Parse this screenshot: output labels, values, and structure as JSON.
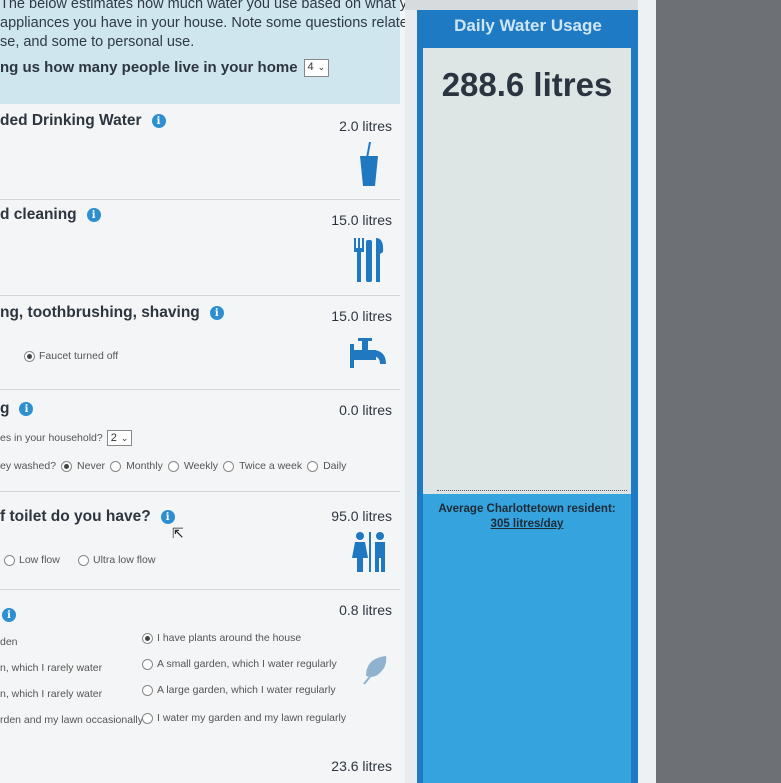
{
  "intro": {
    "line1": "The below estimates how much water you use based on what you do, and",
    "line2": "appliances you have in your house. Note some questions relate to",
    "line3": "se, and some to personal use.",
    "people_label": "ng us how many people live in your home",
    "people_value": "4"
  },
  "sections": {
    "drinking": {
      "title": "ded Drinking Water",
      "litres": "2.0 litres"
    },
    "cleaning": {
      "title": "d cleaning",
      "litres": "15.0 litres"
    },
    "brushing": {
      "title": "ng, toothbrushing, shaving",
      "litres": "15.0 litres",
      "option": "Faucet turned off"
    },
    "washing": {
      "title": "g",
      "litres": "0.0 litres",
      "q1": "es in your household?",
      "q1_value": "2",
      "q2": "ey washed?",
      "options": [
        "Never",
        "Monthly",
        "Weekly",
        "Twice a week",
        "Daily"
      ]
    },
    "toilet": {
      "title": "f toilet do you have?",
      "litres": "95.0 litres",
      "options": [
        "Low flow",
        "Ultra low flow"
      ]
    },
    "garden": {
      "litres": "0.8 litres",
      "left_options": [
        "den",
        "n, which I rarely water",
        "n, which I rarely water",
        "rden and my lawn occasionally"
      ],
      "right_options": [
        "I have plants around the house",
        "A small garden, which I water regularly",
        "A large garden, which I water regularly",
        "I water my garden and my lawn regularly"
      ]
    },
    "last": {
      "litres": "23.6 litres"
    }
  },
  "panel": {
    "title": "Daily Water Usage",
    "value": "288.6 litres",
    "resident_label": "Average Charlottetown resident:",
    "resident_value": "305 litres/day"
  },
  "colors": {
    "panel_blue": "#1f7ac4",
    "water_blue": "#35a3de",
    "icon_blue": "#1f78c0",
    "info_blue": "#2d8fd0"
  }
}
